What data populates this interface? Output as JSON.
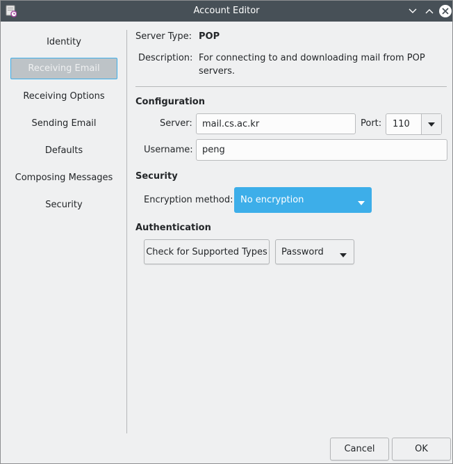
{
  "window": {
    "title": "Account Editor"
  },
  "sidebar": {
    "items": [
      {
        "label": "Identity"
      },
      {
        "label": "Receiving Email"
      },
      {
        "label": "Receiving Options"
      },
      {
        "label": "Sending Email"
      },
      {
        "label": "Defaults"
      },
      {
        "label": "Composing Messages"
      },
      {
        "label": "Security"
      }
    ],
    "selected": "Receiving Email"
  },
  "info": {
    "server_type_label": "Server Type:",
    "server_type_value": "POP",
    "description_label": "Description:",
    "description_line1": "For connecting to and downloading mail from POP",
    "description_line2": "servers."
  },
  "configuration": {
    "heading": "Configuration",
    "server_label": "Server:",
    "server_value": "mail.cs.ac.kr",
    "port_label": "Port:",
    "port_value": "110",
    "username_label": "Username:",
    "username_value": "peng"
  },
  "security": {
    "heading": "Security",
    "encryption_label": "Encryption method:",
    "encryption_value": "No encryption"
  },
  "authentication": {
    "heading": "Authentication",
    "check_button": "Check for Supported Types",
    "method_value": "Password"
  },
  "footer": {
    "cancel_label": "Cancel",
    "ok_label": "OK"
  },
  "colors": {
    "titlebar": "#475057",
    "accent": "#3daee9",
    "selected_bg": "#bdc3c7",
    "window_bg": "#eff0f1"
  }
}
